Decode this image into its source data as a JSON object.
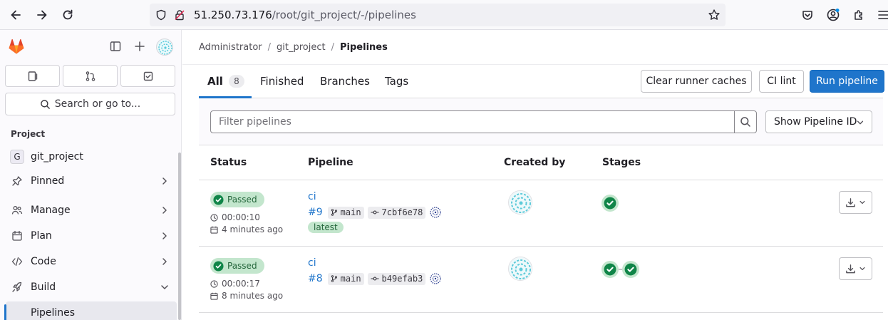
{
  "browser": {
    "url_host": "51.250.73.176",
    "url_path": "/root/git_project/-/pipelines"
  },
  "sidebar": {
    "search_label": "Search or go to...",
    "section_title": "Project",
    "project": {
      "letter": "G",
      "name": "git_project"
    },
    "items": [
      {
        "label": "Pinned",
        "icon": "pin-icon"
      },
      {
        "label": "Manage",
        "icon": "users-icon"
      },
      {
        "label": "Plan",
        "icon": "calendar-icon"
      },
      {
        "label": "Code",
        "icon": "code-icon"
      },
      {
        "label": "Build",
        "icon": "rocket-icon"
      }
    ],
    "sub_item": "Pipelines"
  },
  "breadcrumb": {
    "items": [
      "Administrator",
      "git_project"
    ],
    "current": "Pipelines"
  },
  "tabs": {
    "all": "All",
    "all_count": "8",
    "finished": "Finished",
    "branches": "Branches",
    "tags": "Tags"
  },
  "actions": {
    "clear_caches": "Clear runner caches",
    "ci_lint": "CI lint",
    "run_pipeline": "Run pipeline"
  },
  "filter": {
    "placeholder": "Filter pipelines",
    "show_id": "Show Pipeline ID"
  },
  "table": {
    "headers": {
      "status": "Status",
      "pipeline": "Pipeline",
      "created_by": "Created by",
      "stages": "Stages"
    },
    "rows": [
      {
        "status": "Passed",
        "duration": "00:00:10",
        "finished": "4 minutes ago",
        "name": "ci",
        "id": "#9",
        "branch": "main",
        "commit": "7cbf6e78",
        "badge": "latest",
        "stages_passed": 1
      },
      {
        "status": "Passed",
        "duration": "00:00:17",
        "finished": "8 minutes ago",
        "name": "ci",
        "id": "#8",
        "branch": "main",
        "commit": "b49efab3",
        "badge": "",
        "stages_passed": 2
      }
    ]
  },
  "colors": {
    "accent": "#1f75cb",
    "success": "#108548",
    "success_bg": "#c3e6cd",
    "gitlab_orange": "#e24329"
  }
}
